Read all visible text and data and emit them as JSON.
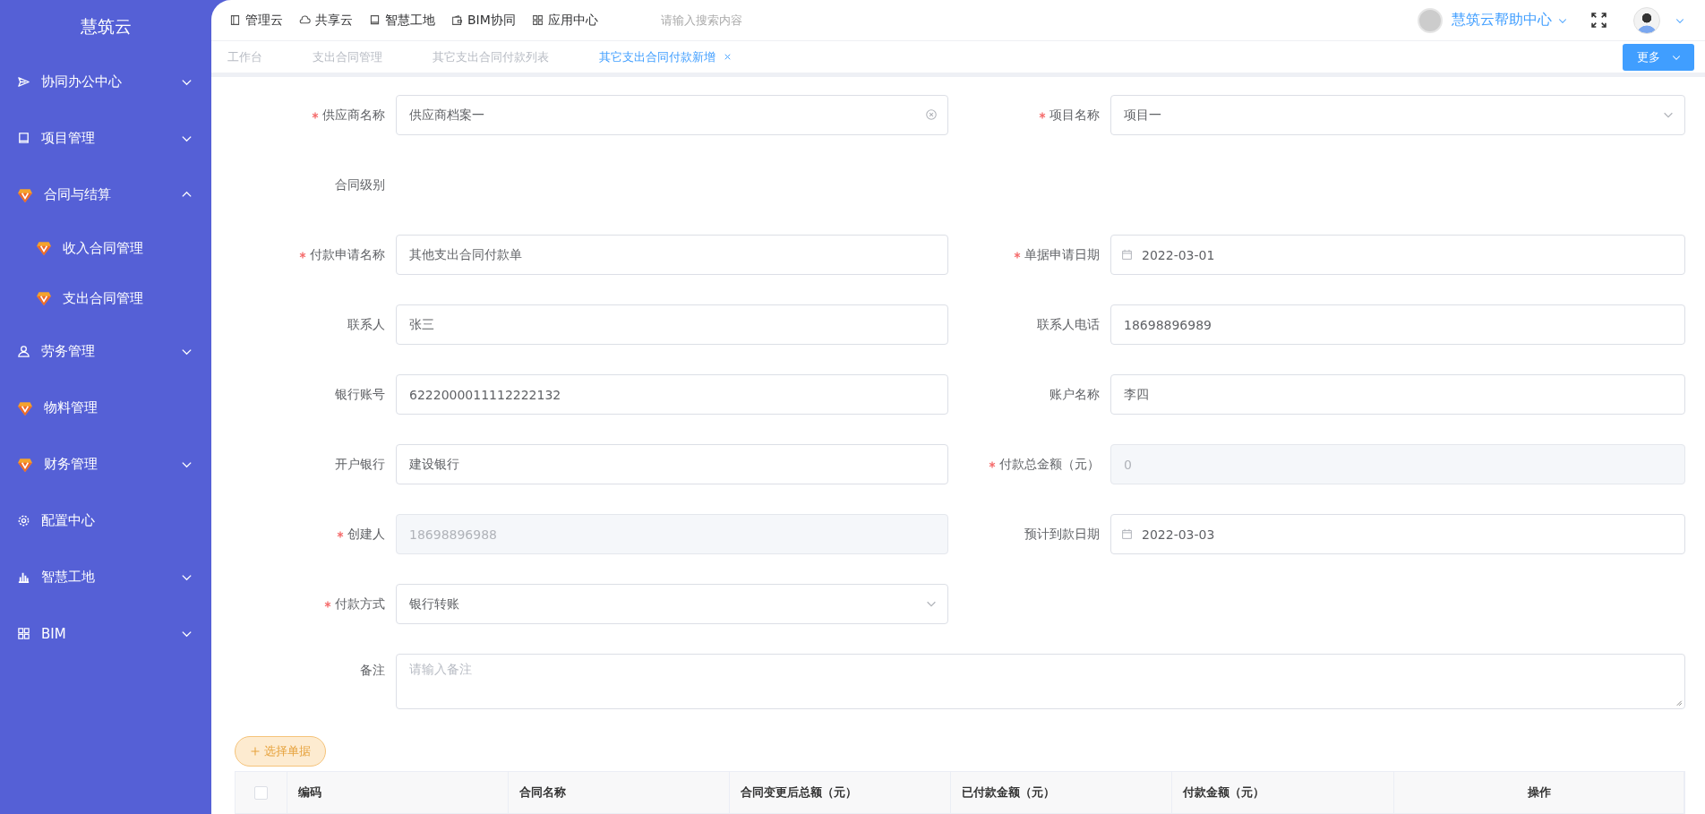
{
  "sidebar": {
    "logo": "慧筑云",
    "items": [
      {
        "label": "协同办公中心",
        "expanded": false
      },
      {
        "label": "项目管理",
        "expanded": false
      },
      {
        "label": "合同与结算",
        "expanded": true,
        "children": [
          {
            "label": "收入合同管理"
          },
          {
            "label": "支出合同管理"
          }
        ]
      },
      {
        "label": "劳务管理",
        "expanded": false
      },
      {
        "label": "物料管理"
      },
      {
        "label": "财务管理",
        "expanded": false
      },
      {
        "label": "配置中心"
      },
      {
        "label": "智慧工地",
        "expanded": false
      },
      {
        "label": "BIM",
        "expanded": false
      }
    ]
  },
  "top_nav": {
    "links": [
      {
        "label": "管理云"
      },
      {
        "label": "共享云"
      },
      {
        "label": "智慧工地"
      },
      {
        "label": "BIM协同"
      },
      {
        "label": "应用中心"
      }
    ],
    "search": {
      "placeholder": "请输入搜索内容"
    },
    "help": "慧筑云帮助中心"
  },
  "tabs": [
    {
      "label": "工作台",
      "selected": false,
      "closable": false
    },
    {
      "label": "支出合同管理",
      "selected": false,
      "closable": false
    },
    {
      "label": "其它支出合同付款列表",
      "selected": false,
      "closable": false
    },
    {
      "label": "其它支出合同付款新增",
      "selected": true,
      "closable": true
    }
  ],
  "more_button": "更多",
  "form": {
    "fields": [
      {
        "label": "供应商名称",
        "required": true,
        "kind": "clearable",
        "value": "供应商档案一"
      },
      {
        "label": "项目名称",
        "required": true,
        "kind": "select",
        "value": "项目一"
      },
      {
        "label": "合同级别",
        "required": false,
        "kind": "label"
      },
      {
        "label": "付款申请名称",
        "required": true,
        "kind": "input",
        "value": "其他支出合同付款单"
      },
      {
        "label": "单据申请日期",
        "required": true,
        "kind": "date",
        "value": "2022-03-01"
      },
      {
        "label": "联系人",
        "required": false,
        "kind": "input",
        "value": "张三"
      },
      {
        "label": "联系人电话",
        "required": false,
        "kind": "input",
        "value": "18698896989"
      },
      {
        "label": "银行账号",
        "required": false,
        "kind": "input",
        "value": "6222000011112222132"
      },
      {
        "label": "账户名称",
        "required": false,
        "kind": "input",
        "value": "李四"
      },
      {
        "label": "开户银行",
        "required": false,
        "kind": "input",
        "value": "建设银行"
      },
      {
        "label": "付款总金额（元）",
        "required": true,
        "kind": "disabled",
        "value": "0"
      },
      {
        "label": "创建人",
        "required": true,
        "kind": "disabled",
        "value": "18698896988"
      },
      {
        "label": "预计到款日期",
        "required": false,
        "kind": "date",
        "value": "2022-03-03"
      },
      {
        "label": "付款方式",
        "required": true,
        "kind": "select",
        "value": "银行转账"
      },
      {
        "label": "备注",
        "required": false,
        "kind": "textarea",
        "placeholder": "请输入备注"
      }
    ]
  },
  "select_button": "选择单据",
  "table": {
    "select_all": {
      "checked": false
    },
    "columns": [
      "编码",
      "合同名称",
      "合同变更后总额（元）",
      "已付款金额（元）",
      "付款金额（元）",
      "操作"
    ]
  }
}
